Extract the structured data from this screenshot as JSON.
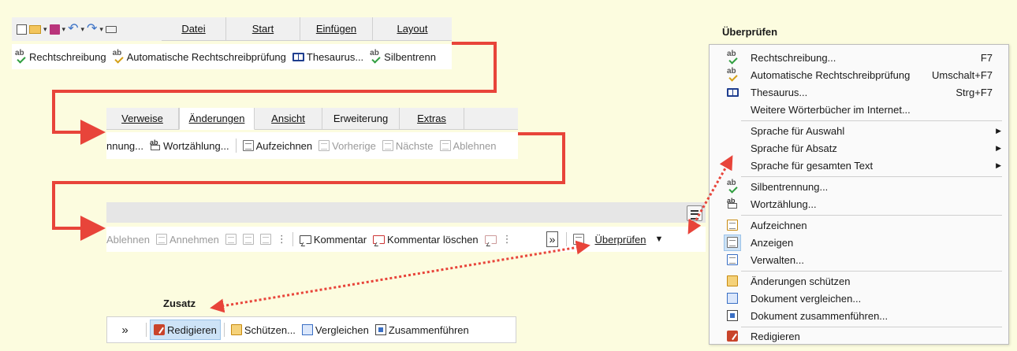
{
  "panel1": {
    "tabs": [
      "Datei",
      "Start",
      "Einfügen",
      "Layout"
    ],
    "tools": [
      "Rechtschreibung",
      "Automatische Rechtschreibprüfung",
      "Thesaurus...",
      "Silbentrenn"
    ]
  },
  "panel2": {
    "tabs": [
      "Verweise",
      "Änderungen",
      "Ansicht",
      "Erweiterung",
      "Extras"
    ],
    "tools": [
      "nnung...",
      "Wortzählung...",
      "Aufzeichnen",
      "Vorherige",
      "Nächste",
      "Ablehnen"
    ]
  },
  "panel3": {
    "tools": [
      "Ablehnen",
      "Annehmen",
      "Kommentar",
      "Kommentar löschen",
      "Überprüfen"
    ],
    "overflow_glyph": "»"
  },
  "panel4": {
    "heading": "Zusatz",
    "overflow_glyph": "»",
    "tools": [
      "Redigieren",
      "Schützen...",
      "Vergleichen",
      "Zusammenführen"
    ]
  },
  "menu": {
    "heading": "Überprüfen",
    "items": [
      {
        "label": "Rechtschreibung...",
        "shortcut": "F7",
        "icon": "spellcheck-icon"
      },
      {
        "label": "Automatische Rechtschreibprüfung",
        "shortcut": "Umschalt+F7",
        "icon": "auto-spellcheck-icon"
      },
      {
        "label": "Thesaurus...",
        "shortcut": "Strg+F7",
        "icon": "thesaurus-icon"
      },
      {
        "label": "Weitere Wörterbücher im Internet...",
        "shortcut": "",
        "icon": ""
      },
      {
        "label": "Sprache für Auswahl",
        "shortcut": "",
        "icon": "",
        "submenu": true
      },
      {
        "label": "Sprache für Absatz",
        "shortcut": "",
        "icon": "",
        "submenu": true
      },
      {
        "label": "Sprache für gesamten Text",
        "shortcut": "",
        "icon": "",
        "submenu": true
      },
      {
        "label": "Silbentrennung...",
        "shortcut": "",
        "icon": "hyphenation-icon"
      },
      {
        "label": "Wortzählung...",
        "shortcut": "",
        "icon": "word-count-icon"
      },
      {
        "label": "Aufzeichnen",
        "shortcut": "",
        "icon": "record-changes-icon"
      },
      {
        "label": "Anzeigen",
        "shortcut": "",
        "icon": "show-changes-icon"
      },
      {
        "label": "Verwalten...",
        "shortcut": "",
        "icon": "manage-changes-icon"
      },
      {
        "label": "Änderungen schützen",
        "shortcut": "",
        "icon": "protect-changes-icon"
      },
      {
        "label": "Dokument vergleichen...",
        "shortcut": "",
        "icon": "compare-document-icon"
      },
      {
        "label": "Dokument zusammenführen...",
        "shortcut": "",
        "icon": "merge-document-icon"
      },
      {
        "label": "Redigieren",
        "shortcut": "",
        "icon": "redact-icon"
      }
    ]
  },
  "colors": {
    "background": "#FCFCDF",
    "arrow": "#E8443A",
    "selected": "#CDE3F7"
  }
}
